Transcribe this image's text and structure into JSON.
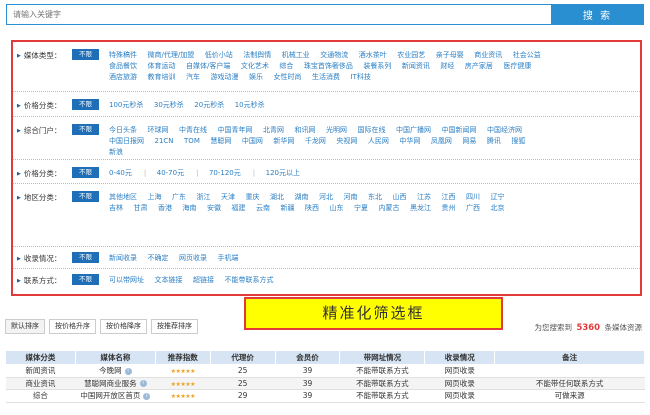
{
  "search": {
    "placeholder": "请输入关键字",
    "button_label": "搜 索"
  },
  "filters": {
    "all_label": "不限",
    "rows": [
      {
        "label": "媒体类型：",
        "lines": [
          [
            "特殊稿件",
            "微商/代理/加盟",
            "低价小站",
            "法制舆情",
            "机械工业",
            "交通物流",
            "酒水茶叶",
            "农业园艺",
            "亲子母婴",
            "商业资讯",
            "社会公益"
          ],
          [
            "食品餐饮",
            "体育运动",
            "自媒体/客户端",
            "文化艺术",
            "综合",
            "珠宝首饰奢侈品",
            "装餐系列",
            "新闻资讯",
            "财经",
            "房产家居",
            "医疗健康"
          ],
          [
            "酒店旅游",
            "教育培训",
            "汽车",
            "游戏动漫",
            "娱乐",
            "女性时尚",
            "生活消费",
            "IT科技"
          ]
        ]
      },
      {
        "label": "价格分类：",
        "lines": [
          [
            "100元秒杀",
            "30元秒杀",
            "20元秒杀",
            "10元秒杀"
          ]
        ]
      },
      {
        "label": "综合门户：",
        "lines": [
          [
            "今日头条",
            "环球网",
            "中青在线",
            "中国青年网",
            "北青网",
            "和讯网",
            "光明网",
            "国际在线",
            "中国广播网",
            "中国新闻网",
            "中国经济网"
          ],
          [
            "中国日报网",
            "21CN",
            "TOM",
            "慧聪网",
            "中国网",
            "新华网",
            "千龙网",
            "央视网",
            "人民网",
            "中华网",
            "凤凰网",
            "网易",
            "腾讯",
            "搜狐"
          ],
          [
            "新浪"
          ]
        ]
      },
      {
        "label": "价格分类：",
        "lines": [
          [
            "0-40元",
            "40-70元",
            "70-120元",
            "120元以上"
          ]
        ]
      },
      {
        "label": "地区分类：",
        "lines": [
          [
            "其他地区",
            "上海",
            "广东",
            "浙江",
            "天津",
            "重庆",
            "湖北",
            "湖南",
            "河北",
            "河南",
            "东北",
            "山西",
            "江苏",
            "江西",
            "四川",
            "辽宁"
          ],
          [
            "吉林",
            "甘肃",
            "香港",
            "海南",
            "安徽",
            "福建",
            "云南",
            "新疆",
            "陕西",
            "山东",
            "宁夏",
            "内蒙古",
            "黑龙江",
            "贵州",
            "广西",
            "北京"
          ]
        ]
      },
      {
        "label": "收录情况：",
        "lines": [
          [
            "新闻收录",
            "不确定",
            "网页收录",
            "手机端"
          ]
        ]
      },
      {
        "label": "联系方式：",
        "lines": [
          [
            "可以带网址",
            "文本链接",
            "超链接",
            "不能带联系方式"
          ]
        ]
      }
    ]
  },
  "callout": {
    "text": "精准化筛选框"
  },
  "sort": {
    "buttons": [
      "默认排序",
      "按价格升序",
      "按价格降序",
      "按推荐排序"
    ]
  },
  "result": {
    "prefix": "为您搜索到",
    "count": "5360",
    "suffix": "条媒体资源"
  },
  "table": {
    "headers": [
      "媒体分类",
      "媒体名称",
      "推荐指数",
      "代理价",
      "会员价",
      "带网址情况",
      "收录情况",
      "备注"
    ],
    "rows": [
      [
        "新闻资讯",
        "今晚网",
        "★★★★★",
        "25",
        "39",
        "不能带联系方式",
        "网页收录",
        ""
      ],
      [
        "商业资讯",
        "慧聪网商业服务",
        "★★★★★",
        "25",
        "39",
        "不能带联系方式",
        "网页收录",
        "不能带任何联系方式"
      ],
      [
        "综合",
        "中国网开放区首页",
        "★★★★★",
        "29",
        "39",
        "不能带联系方式",
        "网页收录",
        "可做来源"
      ]
    ]
  },
  "colors": {
    "accent": "#2a8fd0",
    "all_button": "#1f6fb8",
    "highlight_border": "#e23a3a",
    "callout_bg": "#ffff00",
    "count": "#e23a3a"
  }
}
